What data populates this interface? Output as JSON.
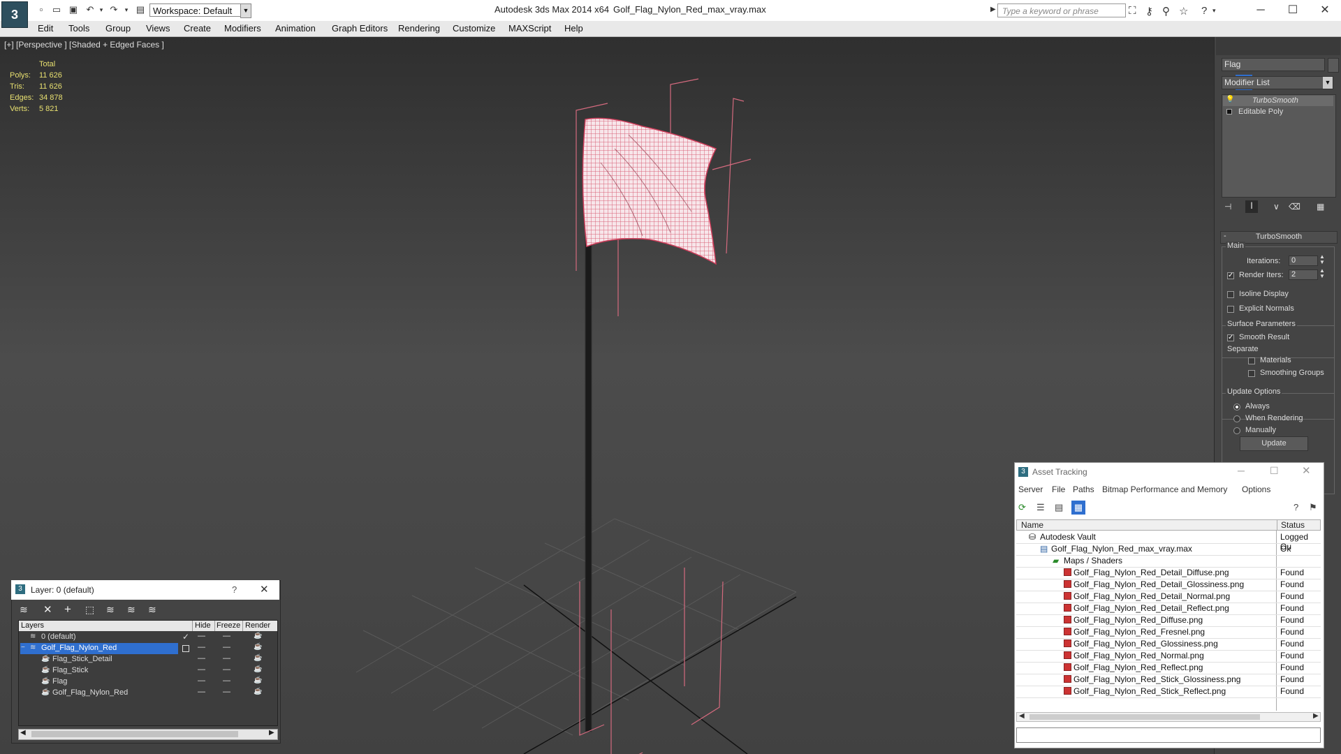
{
  "titlebar": {
    "workspace_label": "Workspace: Default",
    "app_title": "Autodesk 3ds Max  2014 x64",
    "file_title": "Golf_Flag_Nylon_Red_max_vray.max",
    "search_placeholder": "Type a keyword or phrase"
  },
  "menu": [
    "Edit",
    "Tools",
    "Group",
    "Views",
    "Create",
    "Modifiers",
    "Animation",
    "Graph Editors",
    "Rendering",
    "Customize",
    "MAXScript",
    "Help"
  ],
  "viewport": {
    "label": "[+] [Perspective ] [Shaded + Edged Faces ]",
    "stats": {
      "header": "Total",
      "rows": [
        {
          "label": "Polys:",
          "value": "11 626"
        },
        {
          "label": "Tris:",
          "value": "11 626"
        },
        {
          "label": "Edges:",
          "value": "34 878"
        },
        {
          "label": "Verts:",
          "value": "5 821"
        }
      ]
    }
  },
  "command_panel": {
    "object_name": "Flag",
    "modifier_list": "Modifier List",
    "stack": [
      "TurboSmooth",
      "Editable Poly"
    ],
    "rollout_title": "TurboSmooth",
    "main_label": "Main",
    "iterations_label": "Iterations:",
    "iterations_value": "0",
    "render_iters_label": "Render Iters:",
    "render_iters_value": "2",
    "isoline_label": "Isoline Display",
    "explicit_normals_label": "Explicit Normals",
    "surface_params_label": "Surface Parameters",
    "smooth_result_label": "Smooth Result",
    "separate_label": "Separate",
    "materials_label": "Materials",
    "smoothing_groups_label": "Smoothing Groups",
    "update_options_label": "Update Options",
    "always_label": "Always",
    "when_rendering_label": "When Rendering",
    "manually_label": "Manually",
    "update_button": "Update"
  },
  "layer_dialog": {
    "title": "Layer: 0 (default)",
    "help": "?",
    "columns": [
      "Layers",
      "Hide",
      "Freeze",
      "Render"
    ],
    "rows": [
      {
        "name": "0 (default)",
        "indent": 1
      },
      {
        "name": "Golf_Flag_Nylon_Red",
        "indent": 1
      },
      {
        "name": "Flag_Stick_Detail",
        "indent": 2
      },
      {
        "name": "Flag_Stick",
        "indent": 2
      },
      {
        "name": "Flag",
        "indent": 2
      },
      {
        "name": "Golf_Flag_Nylon_Red",
        "indent": 2
      }
    ]
  },
  "asset_tracking": {
    "title": "Asset Tracking",
    "menu": [
      "Server",
      "File",
      "Paths",
      "Bitmap Performance and Memory",
      "Options"
    ],
    "columns": [
      "Name",
      "Status"
    ],
    "rows": [
      {
        "name": "Autodesk Vault",
        "status": "Logged Ou",
        "level": 0,
        "icon": "vault-icon"
      },
      {
        "name": "Golf_Flag_Nylon_Red_max_vray.max",
        "status": "Ok",
        "level": 1,
        "icon": "max-file-icon"
      },
      {
        "name": "Maps / Shaders",
        "status": "",
        "level": 2,
        "icon": "maps-icon"
      },
      {
        "name": "Golf_Flag_Nylon_Red_Detail_Diffuse.png",
        "status": "Found",
        "level": 3,
        "icon": "png-icon"
      },
      {
        "name": "Golf_Flag_Nylon_Red_Detail_Glossiness.png",
        "status": "Found",
        "level": 3,
        "icon": "png-icon"
      },
      {
        "name": "Golf_Flag_Nylon_Red_Detail_Normal.png",
        "status": "Found",
        "level": 3,
        "icon": "png-icon"
      },
      {
        "name": "Golf_Flag_Nylon_Red_Detail_Reflect.png",
        "status": "Found",
        "level": 3,
        "icon": "png-icon"
      },
      {
        "name": "Golf_Flag_Nylon_Red_Diffuse.png",
        "status": "Found",
        "level": 3,
        "icon": "png-icon"
      },
      {
        "name": "Golf_Flag_Nylon_Red_Fresnel.png",
        "status": "Found",
        "level": 3,
        "icon": "png-icon"
      },
      {
        "name": "Golf_Flag_Nylon_Red_Glossiness.png",
        "status": "Found",
        "level": 3,
        "icon": "png-icon"
      },
      {
        "name": "Golf_Flag_Nylon_Red_Normal.png",
        "status": "Found",
        "level": 3,
        "icon": "png-icon"
      },
      {
        "name": "Golf_Flag_Nylon_Red_Reflect.png",
        "status": "Found",
        "level": 3,
        "icon": "png-icon"
      },
      {
        "name": "Golf_Flag_Nylon_Red_Stick_Glossiness.png",
        "status": "Found",
        "level": 3,
        "icon": "png-icon"
      },
      {
        "name": "Golf_Flag_Nylon_Red_Stick_Reflect.png",
        "status": "Found",
        "level": 3,
        "icon": "png-icon"
      }
    ]
  },
  "colors": {
    "selection_blue": "#2f6fcf",
    "wireframe_pink": "#d46a7e",
    "stats_yellow": "#e8e070"
  }
}
